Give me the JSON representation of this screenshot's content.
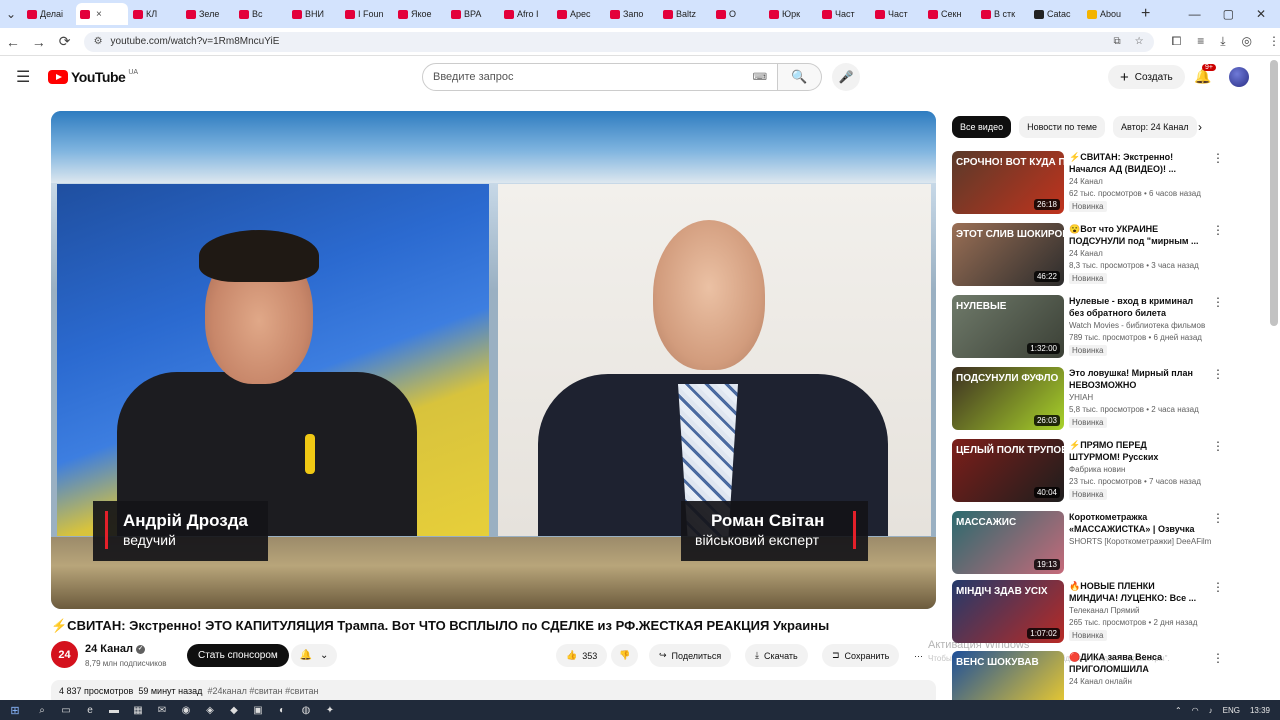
{
  "browser": {
    "tabs": [
      {
        "title": "Делаі",
        "fav": "red"
      },
      {
        "title": "",
        "fav": "red",
        "active": true
      },
      {
        "title": "КЛ",
        "fav": "red"
      },
      {
        "title": "Зеле",
        "fav": "red"
      },
      {
        "title": "Вс",
        "fav": "red"
      },
      {
        "title": "ВНИ",
        "fav": "red"
      },
      {
        "title": "I Foun",
        "fav": "red"
      },
      {
        "title": "Якое",
        "fav": "red"
      },
      {
        "title": "ВРА",
        "fav": "red"
      },
      {
        "title": "Afro I",
        "fav": "red"
      },
      {
        "title": "Арес",
        "fav": "red"
      },
      {
        "title": "Запо",
        "fav": "red"
      },
      {
        "title": "Baltz",
        "fav": "red"
      },
      {
        "title": "О",
        "fav": "red"
      },
      {
        "title": "Юрк",
        "fav": "red"
      },
      {
        "title": "Част",
        "fav": "red"
      },
      {
        "title": "Част",
        "fav": "red"
      },
      {
        "title": "Секн",
        "fav": "red"
      },
      {
        "title": "В стк",
        "fav": "red"
      },
      {
        "title": "Catac",
        "fav": "dark"
      },
      {
        "title": "Abou",
        "fav": "yellow"
      }
    ],
    "tab_close_glyph": "×",
    "new_tab_glyph": "+",
    "url": "youtube.com/watch?v=1Rm8MncuYiE",
    "nav": {
      "back": "←",
      "forward": "→",
      "reload": "⟳"
    },
    "window_controls": {
      "minimize": "—",
      "maximize": "▢",
      "close": "✕"
    }
  },
  "youtube": {
    "logo_text": "YouTube",
    "logo_region": "UA",
    "search_placeholder": "Введите запрос",
    "create_label": "Создать",
    "notif_count": "9+"
  },
  "video": {
    "left_name": "Андрій Дрозда",
    "left_role": "ведучий",
    "right_name": "Роман Світан",
    "right_role": "військовий експерт",
    "title": "⚡СВИТАН: Экстренно! ЭТО КАПИТУЛЯЦИЯ Трампа. Вот ЧТО ВСПЛЫЛО по СДЕЛКЕ из РФ.ЖЕСТКАЯ РЕАКЦИЯ Украины",
    "channel_avatar_text": "24",
    "channel_avatar_sub": "КАНАЛ",
    "channel_name": "24 Канал",
    "subscribers": "8,79 млн подписчиков",
    "sponsor_label": "Стать спонсором",
    "likes": "353",
    "share_label": "Поделиться",
    "download_label": "Скачать",
    "save_label": "Сохранить",
    "more_glyph": "···",
    "desc_views": "4 837 просмотров",
    "desc_time": "59 минут назад",
    "desc_tags": "#24канал #свитан #свитан"
  },
  "watermark": {
    "line1": "Активация Windows",
    "line2": "Чтобы активировать Windows, перейдите в раздел \"Параметры\"."
  },
  "chips": [
    "Все видео",
    "Новости по теме",
    "Автор: 24 Канал"
  ],
  "recommendations": [
    {
      "title": "⚡СВИТАН: Экстренно! Начался АД (ВИДЕО)! ...",
      "channel": "24 Канал",
      "meta": "62 тыс. просмотров • 6 часов назад",
      "badge": "Новинка",
      "duration": "26:18",
      "thumb_text": "СРОЧНО! ВОТ КУДА ПОПАЛ МАДЯР!",
      "thumb_colors": [
        "#5a3a2a",
        "#c0331d"
      ]
    },
    {
      "title": "😮Вот что УКРАИНЕ ПОДСУНУЛИ под \"мирным ...",
      "channel": "24 Канал",
      "meta": "8,3 тыс. просмотров • 3 часа назад",
      "badge": "Новинка",
      "duration": "46:22",
      "thumb_text": "ЭТОТ СЛИВ ШОКИРОВАЛ ВСЕ",
      "thumb_colors": [
        "#9a6f55",
        "#2c2c2c"
      ]
    },
    {
      "title": "Нулевые - вход в криминал без обратного билета",
      "channel": "Watch Movies - библиотека фильмов",
      "meta": "789 тыс. просмотров • 6 дней назад",
      "badge": "Новинка",
      "duration": "1:32:00",
      "thumb_text": "НУЛЕВЫЕ",
      "thumb_colors": [
        "#6f7a6a",
        "#3b4036"
      ]
    },
    {
      "title": "Это ловушка! Мирный план НЕВОЗМОЖНО реализовать...",
      "channel": "УНІАН",
      "meta": "5,8 тыс. просмотров • 2 часа назад",
      "badge": "Новинка",
      "duration": "26:03",
      "thumb_text": "ПОДСУНУЛИ ФУФЛО",
      "thumb_colors": [
        "#3c2f22",
        "#a8d22a"
      ]
    },
    {
      "title": "⚡ПРЯМО ПЕРЕД ШТУРМОМ! Русских случайно ...",
      "channel": "Фабрика новин",
      "meta": "23 тыс. просмотров • 7 часов назад",
      "badge": "Новинка",
      "duration": "40:04",
      "thumb_text": "ЦЕЛЫЙ ПОЛК ТРУПОВ!",
      "thumb_colors": [
        "#7d1f1a",
        "#1d1d1d"
      ]
    },
    {
      "title": "Короткометражка «МАССАЖИСТКА» | Озвучка ...",
      "channel": "SHORTS [Короткометражки] DeeAFilm",
      "meta": "",
      "badge": "",
      "duration": "19:13",
      "thumb_text": "МАССАЖИС",
      "thumb_colors": [
        "#2b6a6e",
        "#c56a7a"
      ]
    },
    {
      "title": "🔥НОВЫЕ ПЛЕНКИ МИНДИЧА! ЛУЦЕНКО: Все ...",
      "channel": "Телеканал Прямий",
      "meta": "265 тыс. просмотров • 2 дня назад",
      "badge": "Новинка",
      "duration": "1:07:02",
      "thumb_text": "МІНДІЧ ЗДАВ УСІХ",
      "thumb_colors": [
        "#233a6b",
        "#b82a25"
      ]
    },
    {
      "title": "🔴ДИКА заява Венса ПРИГОЛОМШИЛА українців!...",
      "channel": "24 Канал онлайн",
      "meta": "",
      "badge": "",
      "duration": "",
      "thumb_text": "ВЕНС ШОКУВАВ",
      "thumb_colors": [
        "#1d4f9a",
        "#f3cf2b"
      ]
    }
  ],
  "taskbar": {
    "lang": "ENG",
    "time": "13:39"
  }
}
